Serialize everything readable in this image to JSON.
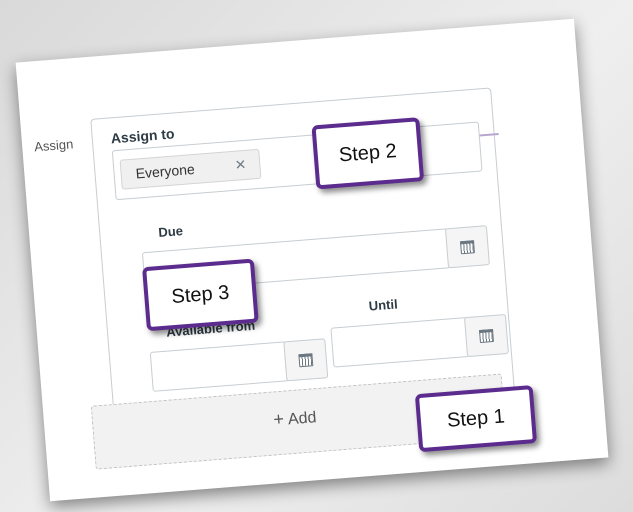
{
  "form": {
    "assign_label": "Assign",
    "assign_to_title": "Assign to",
    "assignee_pill": "Everyone",
    "remove_glyph": "×",
    "due_label": "Due",
    "available_from_label": "Available from",
    "until_label": "Until",
    "add_label": "Add",
    "add_glyph": "+"
  },
  "callouts": {
    "step1": "Step 1",
    "step2": "Step 2",
    "step3": "Step 3"
  },
  "colors": {
    "callout_border": "#5b2b8e",
    "card_border": "#c7cdd1"
  },
  "icons": [
    "calendar-icon",
    "close-icon",
    "plus-icon"
  ]
}
